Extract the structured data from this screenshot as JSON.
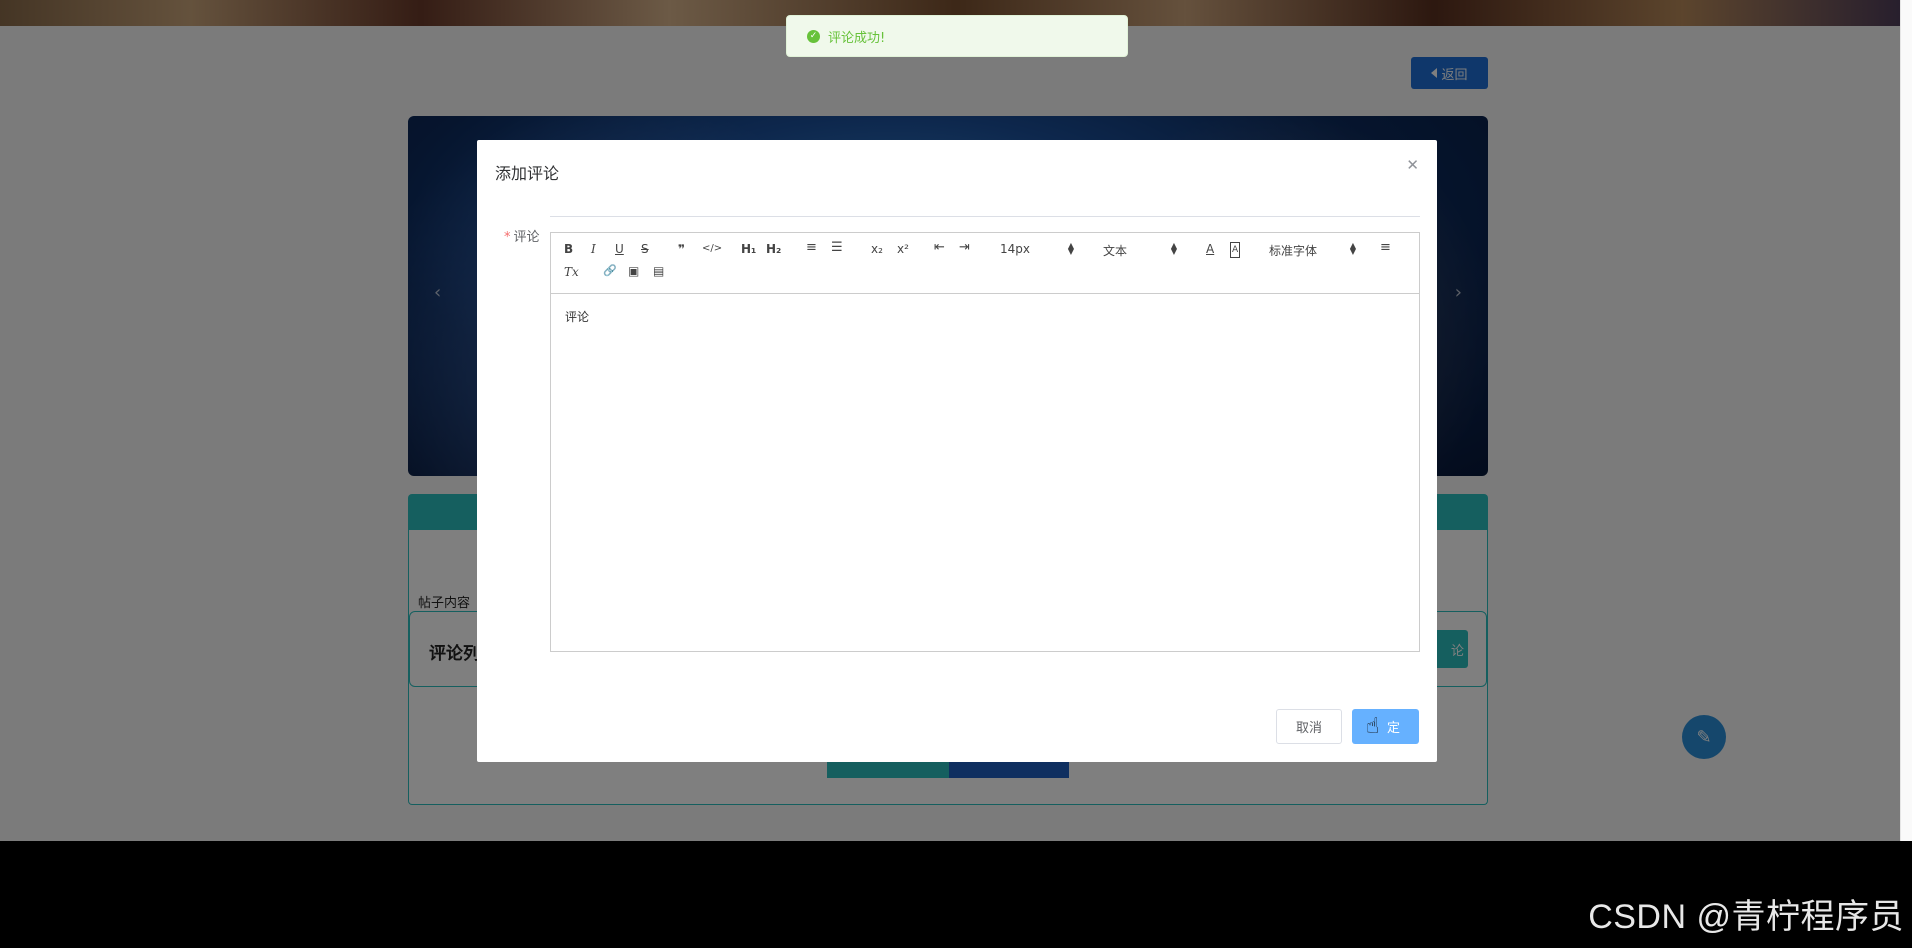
{
  "toast": {
    "text": "评论成功!"
  },
  "header": {
    "back_label": "返回"
  },
  "post": {
    "content_label": "帖子内容",
    "comment_list_title": "评论列",
    "comment_button_partial": "论"
  },
  "dialog": {
    "title": "添加评论",
    "field_label": "评论",
    "editor": {
      "toolbar": {
        "bold": "B",
        "italic": "I",
        "underline": "U",
        "strike": "S",
        "quote": "❞",
        "code": "</>",
        "h1": "H₁",
        "h2": "H₂",
        "ordered_list": "≡",
        "bullet_list": "☰",
        "subscript": "x₂",
        "superscript": "x²",
        "outdent": "⇤",
        "indent": "⇥",
        "size_value": "14px",
        "header_value": "文本",
        "color": "A",
        "background": "A",
        "font_value": "标准字体",
        "align": "≡",
        "clean": "Tx",
        "link": "🔗",
        "image": "▣",
        "video": "▤"
      },
      "content": "评论"
    },
    "cancel_label": "取消",
    "confirm_label": "定"
  },
  "watermark": "CSDN @青柠程序员",
  "colors": {
    "primary": "#1e6fd6",
    "teal": "#2bbfbf",
    "success": "#67c23a",
    "confirm": "#66b1ff",
    "danger": "#f56c6c"
  }
}
